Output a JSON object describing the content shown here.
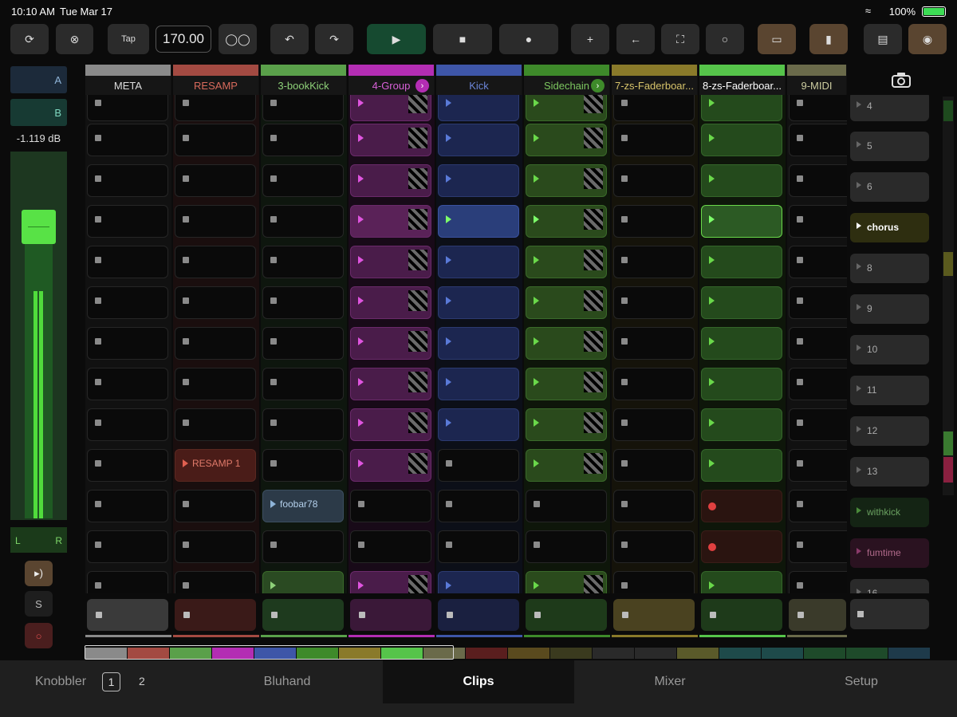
{
  "status": {
    "time": "10:10 AM",
    "date": "Tue Mar 17",
    "battery": "100%"
  },
  "toolbar": {
    "tap": "Tap",
    "tempo": "170.00",
    "icons": [
      "loop-icon",
      "stop-all-clips-icon",
      "tape-icon",
      "undo-icon",
      "redo-icon",
      "play-icon",
      "stop-icon",
      "record-icon",
      "plus-icon",
      "back-arrow-icon",
      "fullscreen-icon",
      "circle-icon",
      "screen-icon",
      "bar-chart-icon",
      "paint-roller-icon",
      "eye-icon"
    ]
  },
  "left": {
    "a": "A",
    "b": "B",
    "db": "-1.119 dB",
    "l": "L",
    "r": "R",
    "solo": "S",
    "volume_level": 0.62
  },
  "columns": [
    {
      "label": "META",
      "color": "#8a8a8a",
      "labelColor": "#ddd"
    },
    {
      "label": "RESAMP",
      "color": "#a34a42",
      "labelColor": "#d86a5c"
    },
    {
      "label": "3-bookKick",
      "color": "#5aa04a",
      "labelColor": "#8dd078"
    },
    {
      "label": "4-Group",
      "color": "#b32db3",
      "labelColor": "#d860d8",
      "arrow": true
    },
    {
      "label": "Kick",
      "color": "#3e56a8",
      "labelColor": "#6b85d8"
    },
    {
      "label": "Sidechain",
      "color": "#3e8a2a",
      "labelColor": "#7dc860",
      "arrow": true
    },
    {
      "label": "7-zs-Faderboar...",
      "color": "#8a7a2a",
      "labelColor": "#d6c36a"
    },
    {
      "label": "8-zs-Faderboar...",
      "color": "#56c44a",
      "labelColor": "#ffffff"
    },
    {
      "label": "9-MIDI",
      "color": "#6a6a4a",
      "labelColor": "#cccca0"
    }
  ],
  "clips": {
    "resamp": "RESAMP 1",
    "bookkick": "foobar78"
  },
  "scenes": [
    "4",
    "5",
    "6",
    "chorus",
    "8",
    "9",
    "10",
    "11",
    "12",
    "13",
    "withkick",
    "fumtime",
    "16"
  ],
  "tabs": {
    "knobbler": "Knobbler",
    "one": "1",
    "two": "2",
    "bluhand": "Bluhand",
    "clips": "Clips",
    "mixer": "Mixer",
    "setup": "Setup"
  }
}
